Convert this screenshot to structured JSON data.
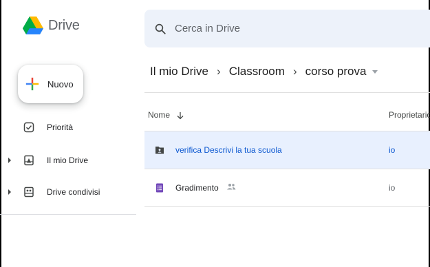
{
  "app": {
    "name": "Drive"
  },
  "search": {
    "placeholder": "Cerca in Drive",
    "value": ""
  },
  "sidebar": {
    "new_button_label": "Nuovo",
    "items": [
      {
        "label": "Priorità",
        "icon": "priority-check-icon",
        "expandable": false
      },
      {
        "label": "Il mio Drive",
        "icon": "my-drive-icon",
        "expandable": true
      },
      {
        "label": "Drive condivisi",
        "icon": "shared-drives-icon",
        "expandable": true
      }
    ]
  },
  "breadcrumb": {
    "items": [
      "Il mio Drive",
      "Classroom",
      "corso prova"
    ]
  },
  "table": {
    "columns": {
      "name": "Nome",
      "owner": "Proprietario"
    },
    "rows": [
      {
        "name": "verifica Descrivi la tua scuola",
        "owner": "io",
        "icon": "shared-folder-icon",
        "selected": true,
        "shared": false
      },
      {
        "name": "Gradimento",
        "owner": "io",
        "icon": "google-forms-icon",
        "selected": false,
        "shared": true
      }
    ]
  },
  "colors": {
    "accent_blue": "#0b57d0",
    "selected_row": "#e8f0fe",
    "search_bg": "#edf2fa",
    "forms_purple": "#7248b9"
  }
}
